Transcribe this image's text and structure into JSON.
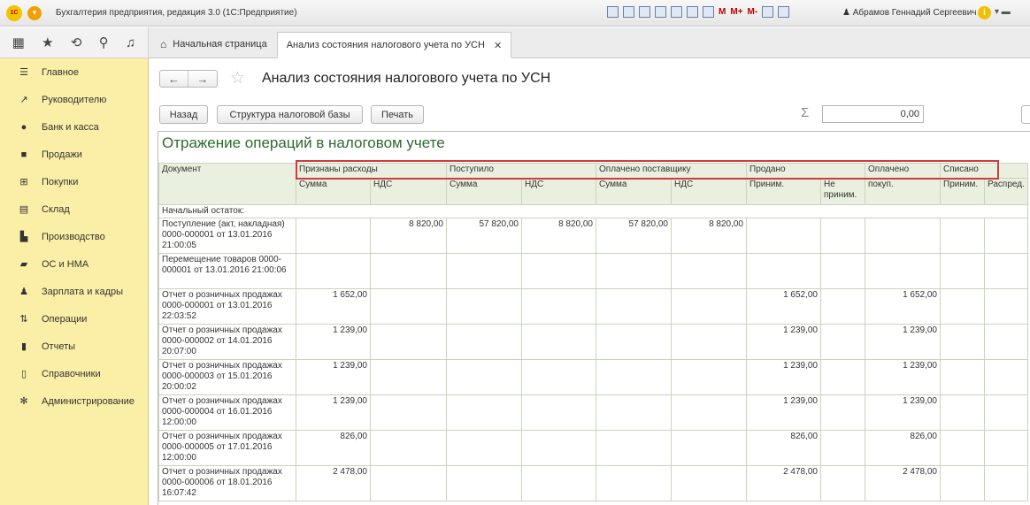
{
  "app": {
    "title": "Бухгалтерия предприятия, редакция 3.0  (1С:Предприятие)",
    "user": "Абрамов Геннадий Сергеевич",
    "toolbar_marks": [
      "M",
      "M+",
      "M-"
    ]
  },
  "tabs": [
    {
      "label": "Начальная страница"
    },
    {
      "label": "Анализ состояния налогового учета по УСН"
    }
  ],
  "sidebar": {
    "items": [
      {
        "label": "Главное",
        "icon": "menu-icon"
      },
      {
        "label": "Руководителю",
        "icon": "chart-trend-icon"
      },
      {
        "label": "Банк и касса",
        "icon": "ruble-coin-icon"
      },
      {
        "label": "Продажи",
        "icon": "shopping-bag-icon"
      },
      {
        "label": "Покупки",
        "icon": "cart-icon"
      },
      {
        "label": "Склад",
        "icon": "warehouse-icon"
      },
      {
        "label": "Производство",
        "icon": "factory-icon"
      },
      {
        "label": "ОС и НМА",
        "icon": "truck-icon"
      },
      {
        "label": "Зарплата и кадры",
        "icon": "person-icon"
      },
      {
        "label": "Операции",
        "icon": "operations-icon"
      },
      {
        "label": "Отчеты",
        "icon": "bar-chart-icon"
      },
      {
        "label": "Справочники",
        "icon": "book-icon"
      },
      {
        "label": "Администрирование",
        "icon": "gear-icon"
      }
    ]
  },
  "page": {
    "title": "Анализ состояния налогового учета по УСН",
    "buttons": {
      "back": "Назад",
      "structure": "Структура налоговой базы",
      "print": "Печать"
    },
    "sum_value": "0,00"
  },
  "report": {
    "title": "Отражение операций в налоговом учете",
    "header": {
      "document": "Документ",
      "groups": [
        "Признаны расходы",
        "Поступило",
        "Оплачено поставщику",
        "Продано",
        "Оплачено",
        "Списано"
      ],
      "sub": [
        "Сумма",
        "НДС",
        "Сумма",
        "НДС",
        "Сумма",
        "НДС",
        "Приним.",
        "Не приним.",
        "покуп.",
        "Приним.",
        "Распред."
      ]
    },
    "opening_label": "Начальный остаток:",
    "rows": [
      {
        "doc": "Поступление (акт, накладная) 0000-000001 от 13.01.2016 21:00:05",
        "c": [
          "",
          "8 820,00",
          "57 820,00",
          "8 820,00",
          "57 820,00",
          "8 820,00",
          "",
          "",
          "",
          "",
          ""
        ]
      },
      {
        "doc": "Перемещение товаров 0000-000001 от 13.01.2016 21:00:06",
        "c": [
          "",
          "",
          "",
          "",
          "",
          "",
          "",
          "",
          "",
          "",
          ""
        ]
      },
      {
        "doc": "Отчет о розничных продажах 0000-000001 от 13.01.2016 22:03:52",
        "c": [
          "1 652,00",
          "",
          "",
          "",
          "",
          "",
          "1 652,00",
          "",
          "1 652,00",
          "",
          ""
        ]
      },
      {
        "doc": "Отчет о розничных продажах 0000-000002 от 14.01.2016 20:07:00",
        "c": [
          "1 239,00",
          "",
          "",
          "",
          "",
          "",
          "1 239,00",
          "",
          "1 239,00",
          "",
          ""
        ]
      },
      {
        "doc": "Отчет о розничных продажах 0000-000003 от 15.01.2016 20:00:02",
        "c": [
          "1 239,00",
          "",
          "",
          "",
          "",
          "",
          "1 239,00",
          "",
          "1 239,00",
          "",
          ""
        ]
      },
      {
        "doc": "Отчет о розничных продажах 0000-000004 от 16.01.2016 12:00:00",
        "c": [
          "1 239,00",
          "",
          "",
          "",
          "",
          "",
          "1 239,00",
          "",
          "1 239,00",
          "",
          ""
        ]
      },
      {
        "doc": "Отчет о розничных продажах 0000-000005 от 17.01.2016 12:00:00",
        "c": [
          "826,00",
          "",
          "",
          "",
          "",
          "",
          "826,00",
          "",
          "826,00",
          "",
          ""
        ]
      },
      {
        "doc": "Отчет о розничных продажах 0000-000006 от 18.01.2016 16:07:42",
        "c": [
          "2 478,00",
          "",
          "",
          "",
          "",
          "",
          "2 478,00",
          "",
          "2 478,00",
          "",
          ""
        ]
      }
    ]
  }
}
